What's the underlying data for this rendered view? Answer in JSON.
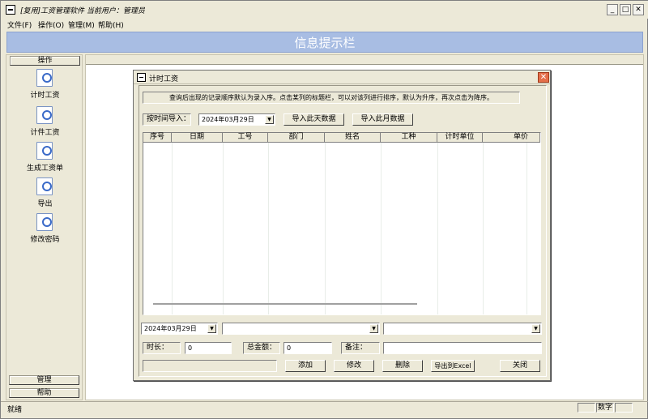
{
  "window": {
    "title": "[复用]工资管理软件 当前用户：管理员"
  },
  "menu": [
    {
      "label": "文件(F)"
    },
    {
      "label": "操作(O)"
    },
    {
      "label": "管理(M)"
    },
    {
      "label": "帮助(H)"
    }
  ],
  "banner": {
    "text": "信息提示栏"
  },
  "left_panel": {
    "header": "操作",
    "items": [
      {
        "label": "计时工资",
        "icon": "magnifier-icon"
      },
      {
        "label": "计件工资",
        "icon": "magnifier-icon"
      },
      {
        "label": "生成工资单",
        "icon": "magnifier-icon"
      },
      {
        "label": "导出",
        "icon": "magnifier-icon"
      },
      {
        "label": "修改密码",
        "icon": "magnifier-icon"
      }
    ],
    "bottom": [
      "管理",
      "帮助"
    ]
  },
  "status": {
    "text": "就绪",
    "panels": [
      "",
      "数字",
      ""
    ]
  },
  "dialog": {
    "title": "计时工资",
    "hint": "查询后出现的记录顺序默认为录入序。点击某列的标题栏，可以对该列进行排序，默认为升序，再次点击为降序。",
    "import_label": "按时间导入：",
    "import_date": "2024年03月29日",
    "import_day_button": "导入此天数据",
    "import_month_button": "导入此月数据",
    "columns": [
      "序号",
      "日期",
      "工号",
      "部门",
      "姓名",
      "工种",
      "计时单位",
      "单价"
    ],
    "rows": [],
    "entry_date": "2024年03月29日",
    "entry_combo1": "",
    "entry_combo2": "",
    "duration_label": "时长：",
    "duration_value": "0",
    "total_label": "总金额：",
    "total_value": "0",
    "note_label": "备注：",
    "note_value": "",
    "buttons": {
      "add": "添加",
      "modify": "修改",
      "delete": "删除",
      "export": "导出到Excel",
      "close": "关闭"
    }
  }
}
